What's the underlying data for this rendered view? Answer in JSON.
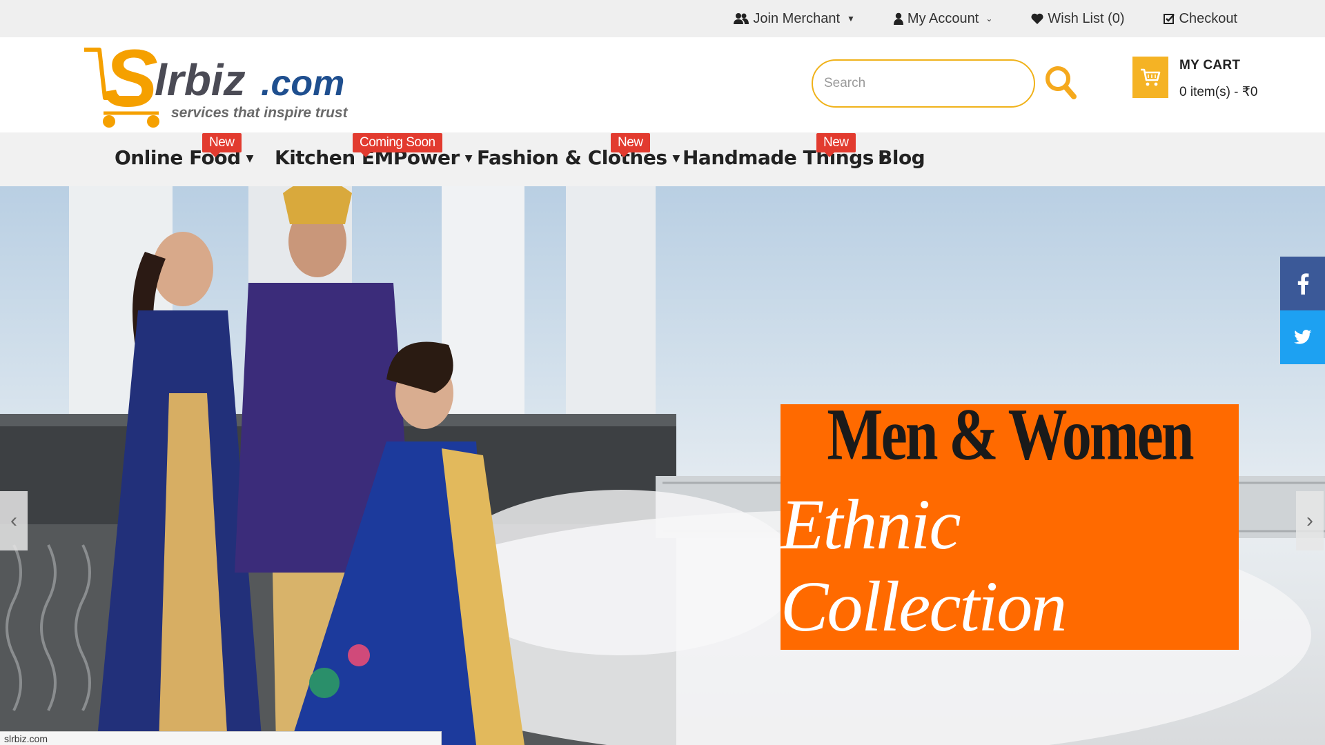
{
  "topbar": {
    "join_merchant": "Join Merchant",
    "my_account": "My Account",
    "wishlist": "Wish List (0)",
    "checkout": "Checkout"
  },
  "header": {
    "logo_text": "Slrbiz.com",
    "logo_tagline": "services that inspire trust",
    "search_placeholder": "Search",
    "cart_title": "MY CART",
    "cart_summary": "0 item(s) - ₹0"
  },
  "nav": {
    "items": [
      {
        "label": "Online Food",
        "badge": "New"
      },
      {
        "label": "Kitchen EMPower",
        "badge": "Coming Soon"
      },
      {
        "label": "Fashion & Clothes",
        "badge": "New"
      },
      {
        "label": "Handmade Things",
        "badge": "New"
      },
      {
        "label": "Blog",
        "badge": ""
      }
    ]
  },
  "hero": {
    "promo_title": "Men & Women",
    "promo_subtitle": "Ethnic Collection",
    "prev": "‹",
    "next": "›"
  },
  "social": {
    "facebook": "f",
    "twitter": "twitter-icon"
  },
  "status_url": "slrbiz.com",
  "colors": {
    "accent": "#f5b324",
    "badge": "#e23b2f",
    "promo": "#ff6a00",
    "facebook": "#3b5998",
    "twitter": "#1da1f2"
  }
}
